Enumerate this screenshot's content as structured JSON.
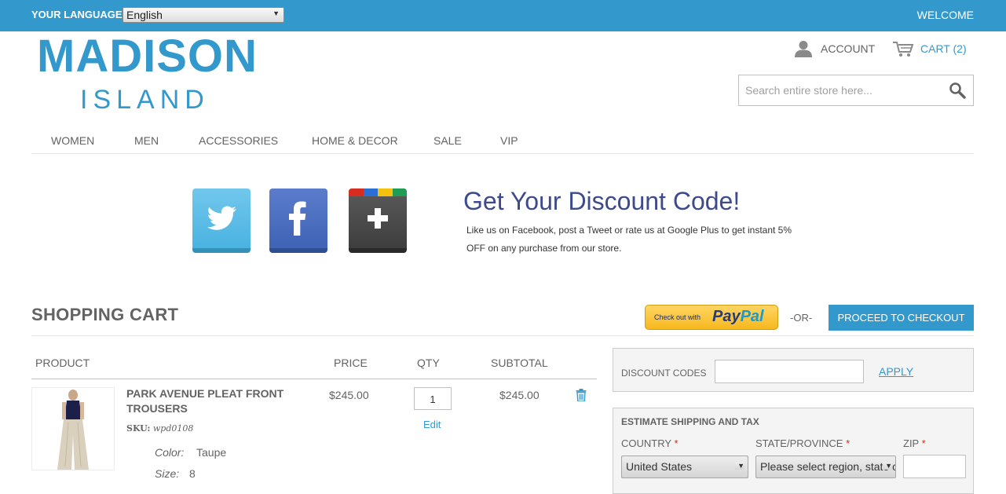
{
  "topbar": {
    "language_label": "YOUR LANGUAGE:",
    "language_value": "English",
    "welcome": "WELCOME"
  },
  "logo": {
    "main": "MADISON",
    "sub": "ISLAND"
  },
  "header": {
    "account": "ACCOUNT",
    "cart": "CART (2)",
    "search_placeholder": "Search entire store here..."
  },
  "nav": [
    "WOMEN",
    "MEN",
    "ACCESSORIES",
    "HOME & DECOR",
    "SALE",
    "VIP"
  ],
  "promo": {
    "social_icons": [
      "twitter-icon",
      "facebook-icon",
      "google-plus-icon"
    ],
    "title": "Get Your Discount Code!",
    "text": "Like us on Facebook, post a Tweet or rate us at Google Plus to get instant 5% OFF on any purchase from our store."
  },
  "cart": {
    "title": "SHOPPING CART",
    "paypal_small": "Check out with",
    "paypal_logo_1": "Pay",
    "paypal_logo_2": "Pal",
    "or": "-OR-",
    "checkout": "PROCEED TO CHECKOUT",
    "columns": {
      "product": "PRODUCT",
      "price": "PRICE",
      "qty": "QTY",
      "subtotal": "SUBTOTAL"
    },
    "items": [
      {
        "name": "PARK AVENUE PLEAT FRONT TROUSERS",
        "sku_label": "SKU:",
        "sku": "wpd0108",
        "color_label": "Color:",
        "color": "Taupe",
        "size_label": "Size:",
        "size": "8",
        "price": "$245.00",
        "qty": "1",
        "edit": "Edit",
        "subtotal": "$245.00"
      }
    ]
  },
  "discount": {
    "label": "DISCOUNT CODES",
    "apply": "APPLY"
  },
  "estimate": {
    "title": "ESTIMATE SHIPPING AND TAX",
    "country_label": "COUNTRY",
    "state_label": "STATE/PROVINCE",
    "zip_label": "ZIP",
    "required_mark": "*",
    "country_value": "United States",
    "state_value": "Please select region, state or province"
  },
  "colors": {
    "accent": "#3399cc",
    "text": "#636363",
    "promo_title": "#3d4a8c",
    "required": "#df280a"
  }
}
